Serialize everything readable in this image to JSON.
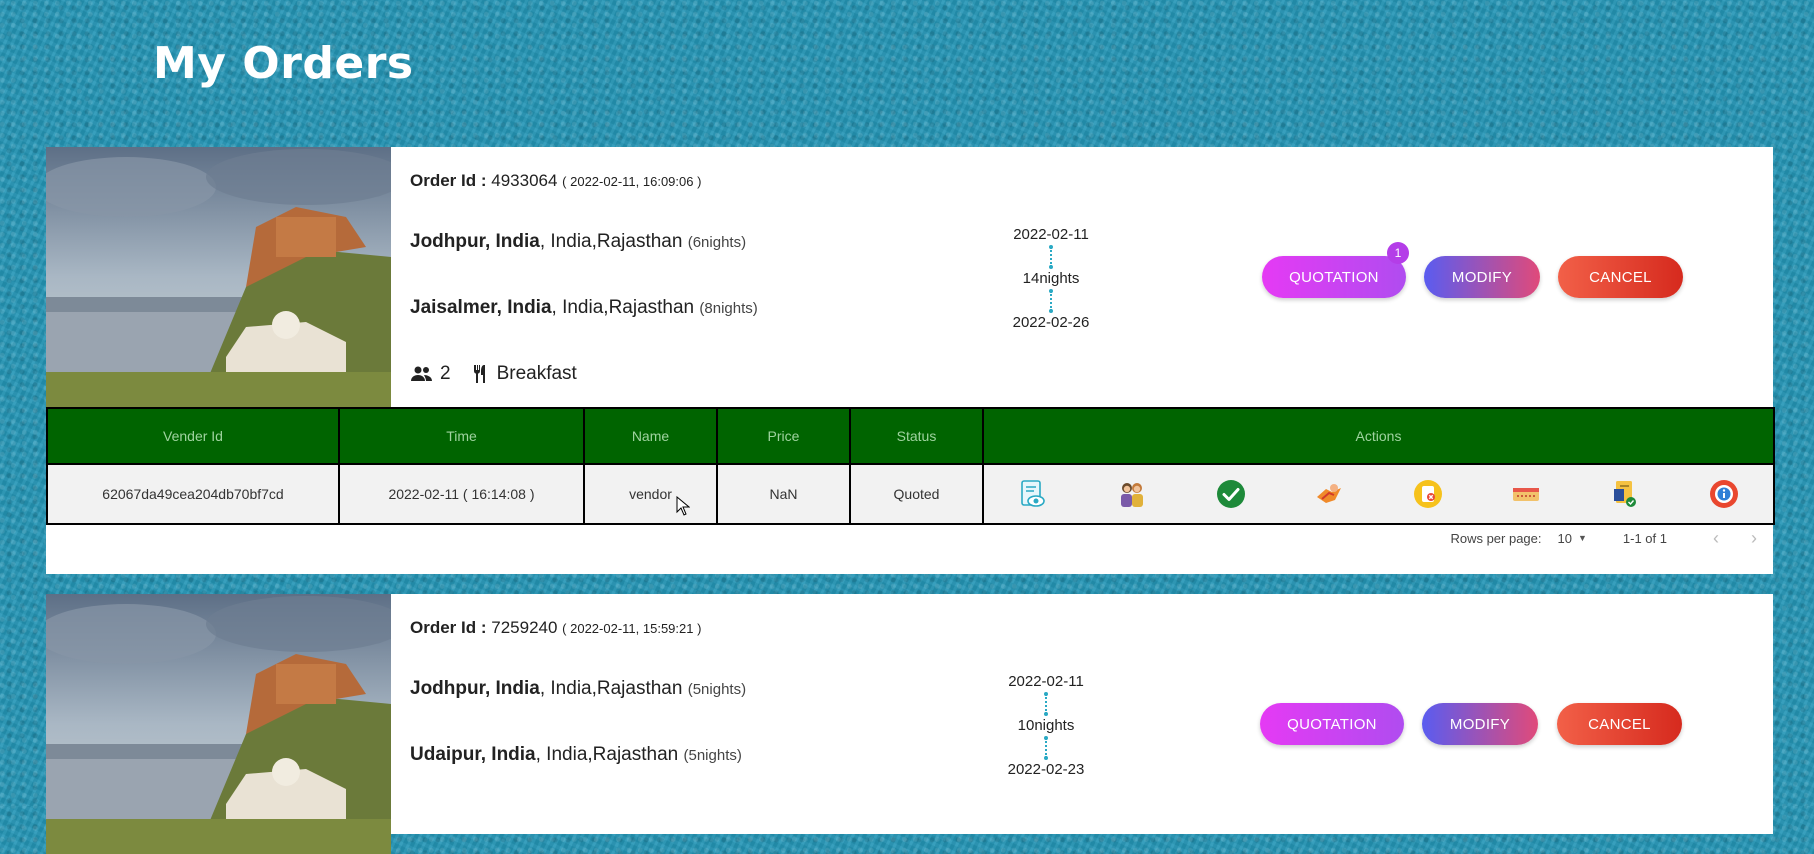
{
  "page": {
    "title": "My Orders"
  },
  "orders": [
    {
      "order_id_label": "Order Id :",
      "order_id": "4933064",
      "timestamp": "( 2022-02-11, 16:09:06 )",
      "destinations": [
        {
          "city": "Jodhpur, India",
          "region": ", India,Rajasthan",
          "nights": "(6nights)"
        },
        {
          "city": "Jaisalmer, India",
          "region": ", India,Rajasthan",
          "nights": "(8nights)"
        }
      ],
      "guests": "2",
      "meal": "Breakfast",
      "start_date": "2022-02-11",
      "duration": "14nights",
      "end_date": "2022-02-26",
      "quotation_label": "QUOTATION",
      "quotation_badge": "1",
      "modify_label": "MODIFY",
      "cancel_label": "CANCEL",
      "table": {
        "headers": [
          "Vender Id",
          "Time",
          "Name",
          "Price",
          "Status",
          "Actions"
        ],
        "rows": [
          {
            "vender_id": "62067da49cea204db70bf7cd",
            "time": "2022-02-11 ( 16:14:08 )",
            "name": "vendor",
            "price": "NaN",
            "status": "Quoted"
          }
        ],
        "action_icons": [
          "view-quote-icon",
          "chat-icon",
          "accept-icon",
          "negotiate-icon",
          "reject-icon",
          "ticket-icon",
          "document-icon",
          "info-icon"
        ]
      },
      "pagination": {
        "rows_per_page_label": "Rows per page:",
        "rows_per_page": "10",
        "range": "1-1 of 1"
      }
    },
    {
      "order_id_label": "Order Id :",
      "order_id": "7259240",
      "timestamp": "( 2022-02-11, 15:59:21 )",
      "destinations": [
        {
          "city": "Jodhpur, India",
          "region": ", India,Rajasthan",
          "nights": "(5nights)"
        },
        {
          "city": "Udaipur, India",
          "region": ", India,Rajasthan",
          "nights": "(5nights)"
        }
      ],
      "start_date": "2022-02-11",
      "duration": "10nights",
      "end_date": "2022-02-23",
      "quotation_label": "QUOTATION",
      "modify_label": "MODIFY",
      "cancel_label": "CANCEL"
    }
  ]
}
